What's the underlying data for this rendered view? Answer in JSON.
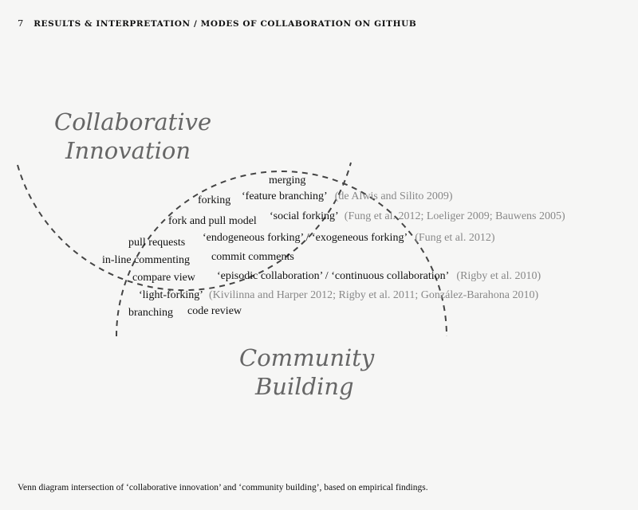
{
  "header": {
    "number": "7",
    "title": "RESULTS & INTERPRETATION / MODES OF COLLABORATION ON GITHUB"
  },
  "diagram": {
    "set_a": [
      "Collaborative",
      "Innovation"
    ],
    "set_b": [
      "Community",
      "Building"
    ],
    "terms": {
      "merging": "merging",
      "forking": "forking",
      "fork_and_pull": "fork and pull model",
      "pull_requests": "pull requests",
      "inline_commenting": "in-line commenting",
      "compare_view": "compare view",
      "branching": "branching",
      "code_review": "code review",
      "commit_comments": "commit comments",
      "feature_branching": "‘feature branching’",
      "feature_branching_cite": "(de Alwis and Silito 2009)",
      "social_forking": "‘social forking’",
      "social_forking_cite": "(Fung et al. 2012; Loeliger 2009; Bauwens 2005)",
      "endo_exo_forking": "‘endogeneous forking’ / ‘exogeneous forking’",
      "endo_exo_cite": "(Fung et al. 2012)",
      "episodic_continuous": "‘episodic collaboration’ / ‘continuous collaboration’",
      "episodic_cite": "(Rigby et al. 2010)",
      "light_forking": "‘light-forking’",
      "light_forking_cite": "(Kivilinna and Harper 2012; Rigby et al. 2011; González-Barahona 2010)"
    }
  },
  "caption": "Venn diagram intersection of ‘collaborative innovation’ and ‘community building’, based on empirical findings."
}
